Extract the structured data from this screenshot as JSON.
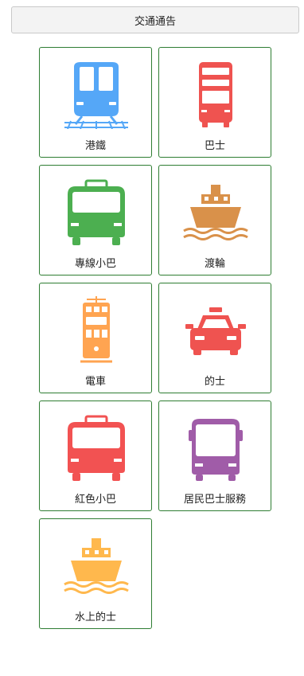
{
  "header": {
    "notice_label": "交通通告"
  },
  "tiles": [
    {
      "label": "港鐵",
      "icon": "mtr-train-icon",
      "color": "#55a7f7"
    },
    {
      "label": "巴士",
      "icon": "double-decker-bus-icon",
      "color": "#ef5350"
    },
    {
      "label": "專線小巴",
      "icon": "green-minibus-icon",
      "color": "#4caf50"
    },
    {
      "label": "渡輪",
      "icon": "ferry-icon",
      "color": "#d9914a"
    },
    {
      "label": "電車",
      "icon": "tram-icon",
      "color": "#ffa451"
    },
    {
      "label": "的士",
      "icon": "taxi-icon",
      "color": "#ef5350"
    },
    {
      "label": "紅色小巴",
      "icon": "red-minibus-icon",
      "color": "#f25252"
    },
    {
      "label": "居民巴士服務",
      "icon": "residents-bus-icon",
      "color": "#a05ca8"
    },
    {
      "label": "水上的士",
      "icon": "water-taxi-icon",
      "color": "#ffb84d"
    }
  ]
}
